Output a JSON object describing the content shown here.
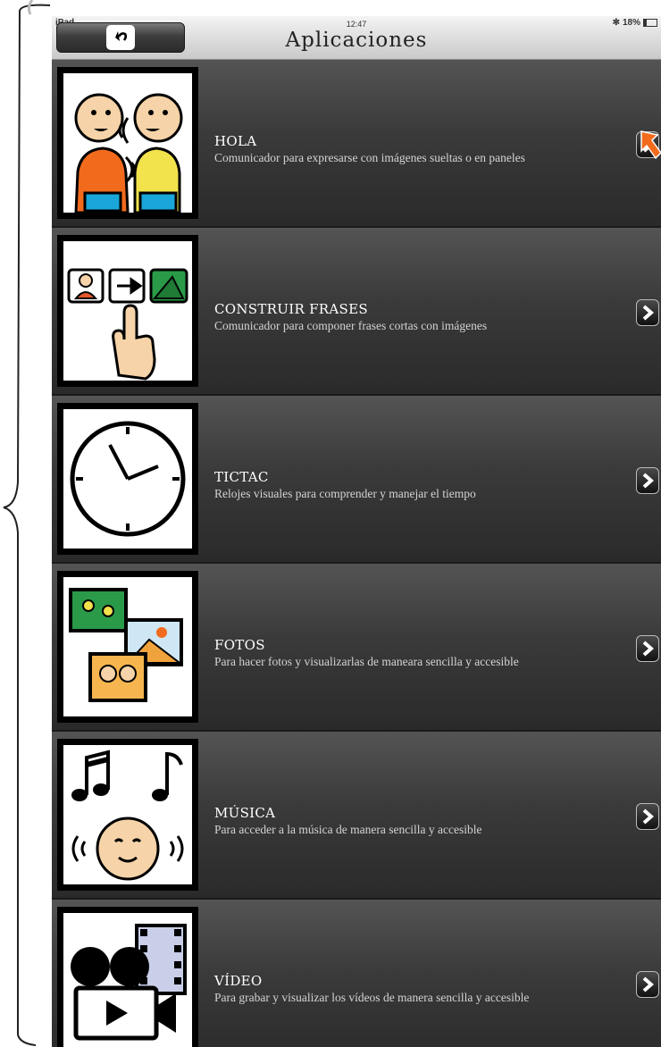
{
  "status_bar": {
    "device": "iPad",
    "time": "12:47",
    "battery": "18%",
    "battery_level": 0.18
  },
  "header": {
    "title": "Aplicaciones",
    "back_icon": "back-arrow-icon"
  },
  "colors": {
    "row_top": "#545454",
    "row_bottom": "#2a2a2a",
    "nav_top": "#f4f4f4",
    "nav_bottom": "#c9c9c9",
    "pointer": "#f26b1d"
  },
  "apps": [
    {
      "title": "HOLA",
      "desc": "Comunicador para expresarse con imágenes sueltas o en paneles",
      "icon": "conversation-icon"
    },
    {
      "title": "CONSTRUIR FRASES",
      "desc": "Comunicador para componer frases cortas con imágenes",
      "icon": "build-sentence-icon"
    },
    {
      "title": "TICTAC",
      "desc": "Relojes visuales para comprender y manejar el tiempo",
      "icon": "clock-icon"
    },
    {
      "title": "FOTOS",
      "desc": "Para hacer fotos y visualizarlas de maneara sencilla y accesible",
      "icon": "photos-icon"
    },
    {
      "title": "MÚSICA",
      "desc": "Para acceder a la música de manera sencilla y accesible",
      "icon": "music-icon"
    },
    {
      "title": "VÍDEO",
      "desc": "Para grabar y visualizar los vídeos de manera sencilla y accesible",
      "icon": "video-icon"
    }
  ]
}
